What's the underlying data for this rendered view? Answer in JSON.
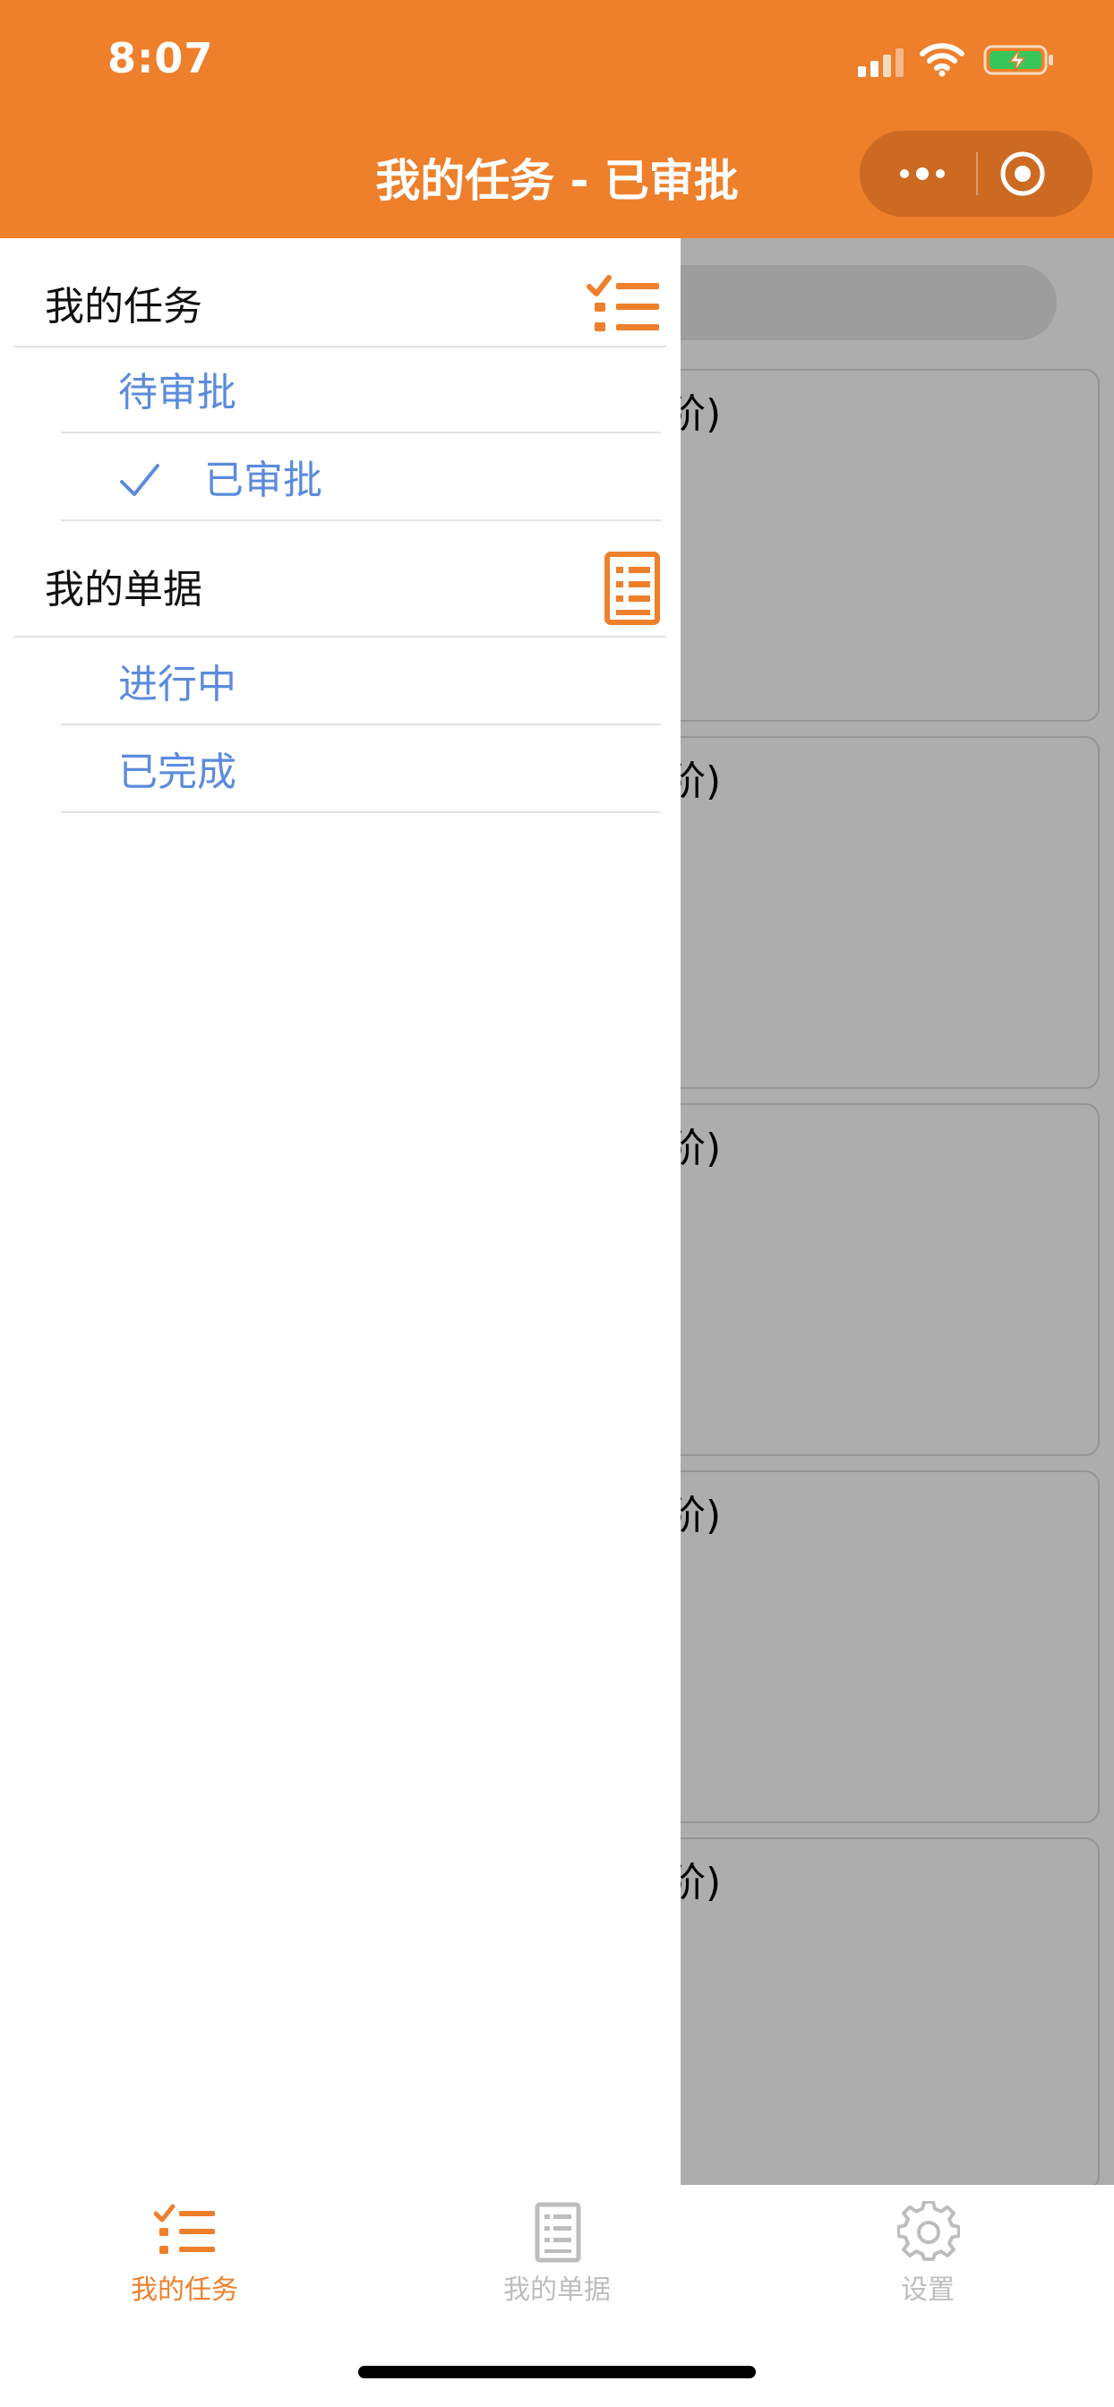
{
  "status_bar": {
    "time": "8:07"
  },
  "nav": {
    "title": "我的任务 - 已审批"
  },
  "colors": {
    "accent": "#EE7F2B",
    "link": "#5B8BDD",
    "inactive": "#BDBDBD",
    "overlay": "rgba(0,0,0,0.32)"
  },
  "drawer": {
    "sections": [
      {
        "title": "我的任务",
        "icon": "task-list-icon",
        "items": [
          {
            "label": "待审批",
            "active": false
          },
          {
            "label": "已审批",
            "active": true
          }
        ]
      },
      {
        "title": "我的单据",
        "icon": "document-icon",
        "items": [
          {
            "label": "进行中",
            "active": false
          },
          {
            "label": "已完成",
            "active": false
          }
        ]
      }
    ]
  },
  "background_cards": [
    {
      "title_fragment": "阶)"
    },
    {
      "title_fragment": "阶)"
    },
    {
      "title_fragment": "阶)"
    },
    {
      "title_fragment": "阶)"
    },
    {
      "title_fragment": "阶)"
    }
  ],
  "tabbar": {
    "tabs": [
      {
        "label": "我的任务",
        "icon": "task-list-icon",
        "active": true
      },
      {
        "label": "我的单据",
        "icon": "document-icon",
        "active": false
      },
      {
        "label": "设置",
        "icon": "gear-icon",
        "active": false
      }
    ]
  }
}
